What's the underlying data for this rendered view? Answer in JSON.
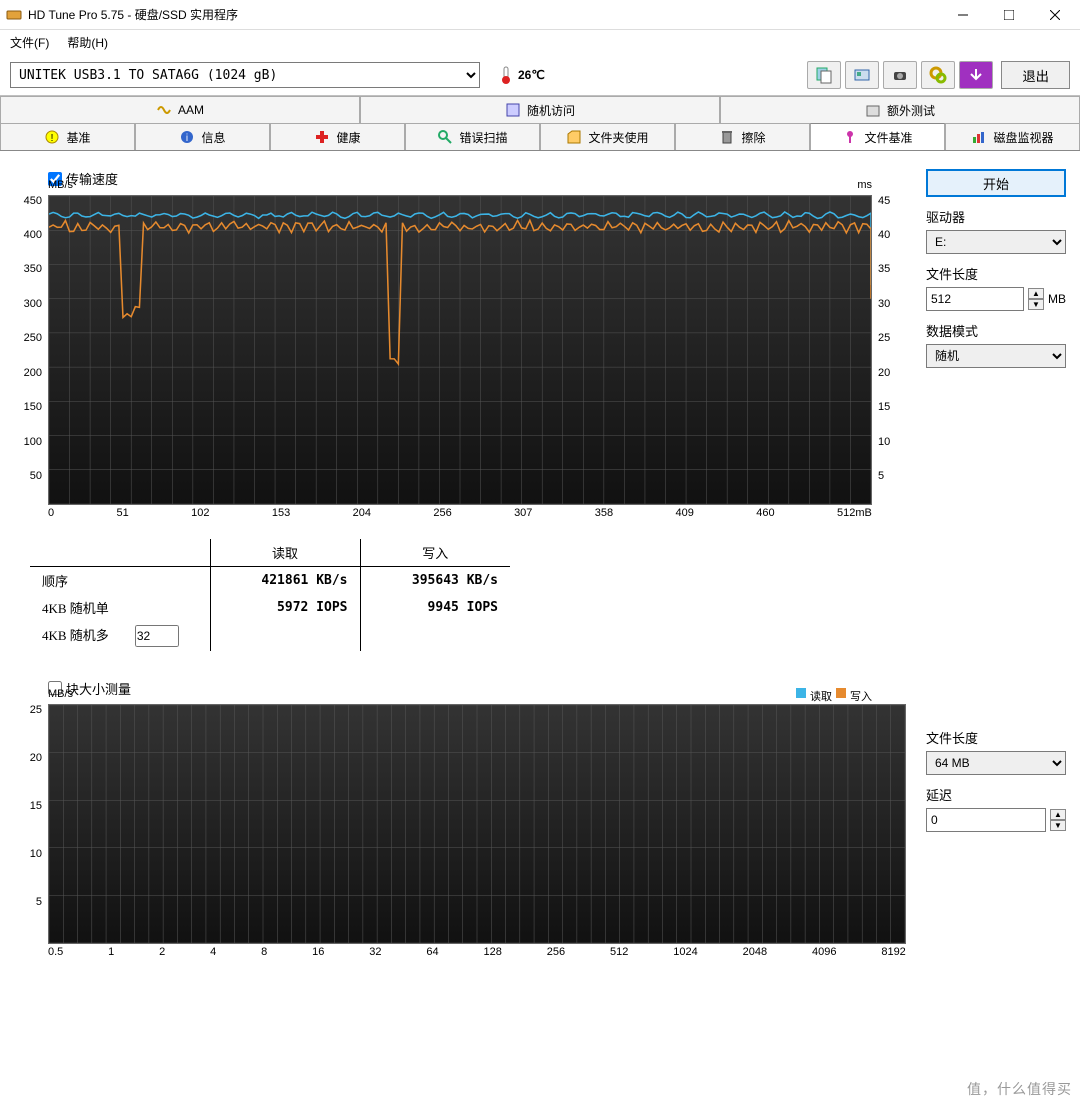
{
  "window": {
    "title": "HD Tune Pro 5.75 - 硬盘/SSD 实用程序"
  },
  "menu": {
    "file": "文件(F)",
    "help": "帮助(H)"
  },
  "toolbar": {
    "drive": "UNITEK  USB3.1 TO SATA6G (1024 gB)",
    "temp": "26℃",
    "exit": "退出"
  },
  "tabs_row1": [
    {
      "label": "AAM"
    },
    {
      "label": "随机访问"
    },
    {
      "label": "额外测试"
    }
  ],
  "tabs_row2": [
    {
      "label": "基准"
    },
    {
      "label": "信息"
    },
    {
      "label": "健康"
    },
    {
      "label": "错误扫描"
    },
    {
      "label": "文件夹使用"
    },
    {
      "label": "擦除"
    },
    {
      "label": "文件基准",
      "active": true
    },
    {
      "label": "磁盘监视器"
    }
  ],
  "side": {
    "start": "开始",
    "drive_label": "驱动器",
    "drive_value": "E:",
    "filelen_label": "文件长度",
    "filelen_value": "512",
    "filelen_unit": "MB",
    "mode_label": "数据模式",
    "mode_value": "随机",
    "filelen2_label": "文件长度",
    "filelen2_value": "64 MB",
    "delay_label": "延迟",
    "delay_value": "0"
  },
  "block1": {
    "checkbox": "传输速度",
    "unit_left": "MB/s",
    "unit_right": "ms",
    "y_left": [
      "450",
      "400",
      "350",
      "300",
      "250",
      "200",
      "150",
      "100",
      "50",
      ""
    ],
    "y_right": [
      "45",
      "40",
      "35",
      "30",
      "25",
      "20",
      "15",
      "10",
      "5",
      ""
    ],
    "x": [
      "0",
      "51",
      "102",
      "153",
      "204",
      "256",
      "307",
      "358",
      "409",
      "460",
      "512mB"
    ]
  },
  "results": {
    "hdr_read": "读取",
    "hdr_write": "写入",
    "row_seq": "顺序",
    "seq_read": "421861 KB/s",
    "seq_write": "395643 KB/s",
    "row_4k1": "4KB 随机单",
    "r4k1_read": "5972 IOPS",
    "r4k1_write": "9945 IOPS",
    "row_4km": "4KB 随机多",
    "qd": "32"
  },
  "block2": {
    "checkbox": "块大小测量",
    "unit_left": "MB/s",
    "legend_read": "读取",
    "legend_write": "写入",
    "y_left": [
      "25",
      "20",
      "15",
      "10",
      "5",
      ""
    ],
    "x": [
      "0.5",
      "1",
      "2",
      "4",
      "8",
      "16",
      "32",
      "64",
      "128",
      "256",
      "512",
      "1024",
      "2048",
      "4096",
      "8192"
    ]
  },
  "chart_data": [
    {
      "type": "line",
      "title": "传输速度",
      "x_range_mb": [
        0,
        512
      ],
      "series": [
        {
          "name": "读取",
          "unit": "MB/s",
          "axis": "left",
          "color": "#3cb4e6",
          "typical": 422,
          "min": 410,
          "max": 430
        },
        {
          "name": "写入",
          "unit": "MB/s",
          "axis": "left",
          "color": "#e68a2e",
          "typical": 405,
          "dips": [
            {
              "x_mb": 50,
              "value": 270
            },
            {
              "x_mb": 215,
              "value": 200
            }
          ]
        }
      ],
      "y_left": {
        "label": "MB/s",
        "range": [
          0,
          450
        ],
        "step": 50
      },
      "y_right": {
        "label": "ms",
        "range": [
          0,
          45
        ],
        "step": 5
      }
    },
    {
      "type": "bar",
      "title": "块大小测量",
      "categories": [
        "0.5",
        "1",
        "2",
        "4",
        "8",
        "16",
        "32",
        "64",
        "128",
        "256",
        "512",
        "1024",
        "2048",
        "4096",
        "8192"
      ],
      "series": [
        {
          "name": "读取",
          "color": "#3cb4e6",
          "values": []
        },
        {
          "name": "写入",
          "color": "#e68a2e",
          "values": []
        }
      ],
      "y_left": {
        "label": "MB/s",
        "range": [
          0,
          25
        ],
        "step": 5
      }
    }
  ],
  "watermark": "值，什么值得买"
}
